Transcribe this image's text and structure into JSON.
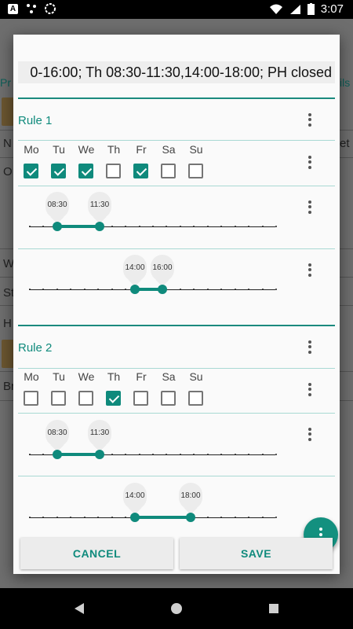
{
  "status": {
    "time": "3:07",
    "left_icons": [
      "a-badge-icon",
      "dots-icon",
      "spinner-icon"
    ],
    "right_icons": [
      "wifi-icon",
      "signal-icon",
      "battery-icon"
    ]
  },
  "background": {
    "tab_left": "Pr",
    "tab_right": "ils",
    "row_labels": [
      "N",
      "O",
      "W",
      "St",
      "H",
      "Br"
    ],
    "row_right": "et"
  },
  "dialog": {
    "summary": "0-16:00; Th 08:30-11:30,14:00-18:00; PH closed",
    "rules": [
      {
        "title": "Rule 1",
        "days": [
          {
            "label": "Mo",
            "checked": true
          },
          {
            "label": "Tu",
            "checked": true
          },
          {
            "label": "We",
            "checked": true
          },
          {
            "label": "Th",
            "checked": false
          },
          {
            "label": "Fr",
            "checked": true
          },
          {
            "label": "Sa",
            "checked": false
          },
          {
            "label": "Su",
            "checked": false
          }
        ],
        "ranges": [
          {
            "start": "08:30",
            "end": "11:30"
          },
          {
            "start": "14:00",
            "end": "16:00"
          }
        ]
      },
      {
        "title": "Rule 2",
        "days": [
          {
            "label": "Mo",
            "checked": false
          },
          {
            "label": "Tu",
            "checked": false
          },
          {
            "label": "We",
            "checked": false
          },
          {
            "label": "Th",
            "checked": true
          },
          {
            "label": "Fr",
            "checked": false
          },
          {
            "label": "Sa",
            "checked": false
          },
          {
            "label": "Su",
            "checked": false
          }
        ],
        "ranges": [
          {
            "start": "08:30",
            "end": "11:30"
          },
          {
            "start": "14:00",
            "end": "18:00"
          }
        ]
      }
    ],
    "cancel_label": "CANCEL",
    "save_label": "SAVE"
  },
  "colors": {
    "accent": "#0f8a7c",
    "divider": "#a9d9d3"
  }
}
